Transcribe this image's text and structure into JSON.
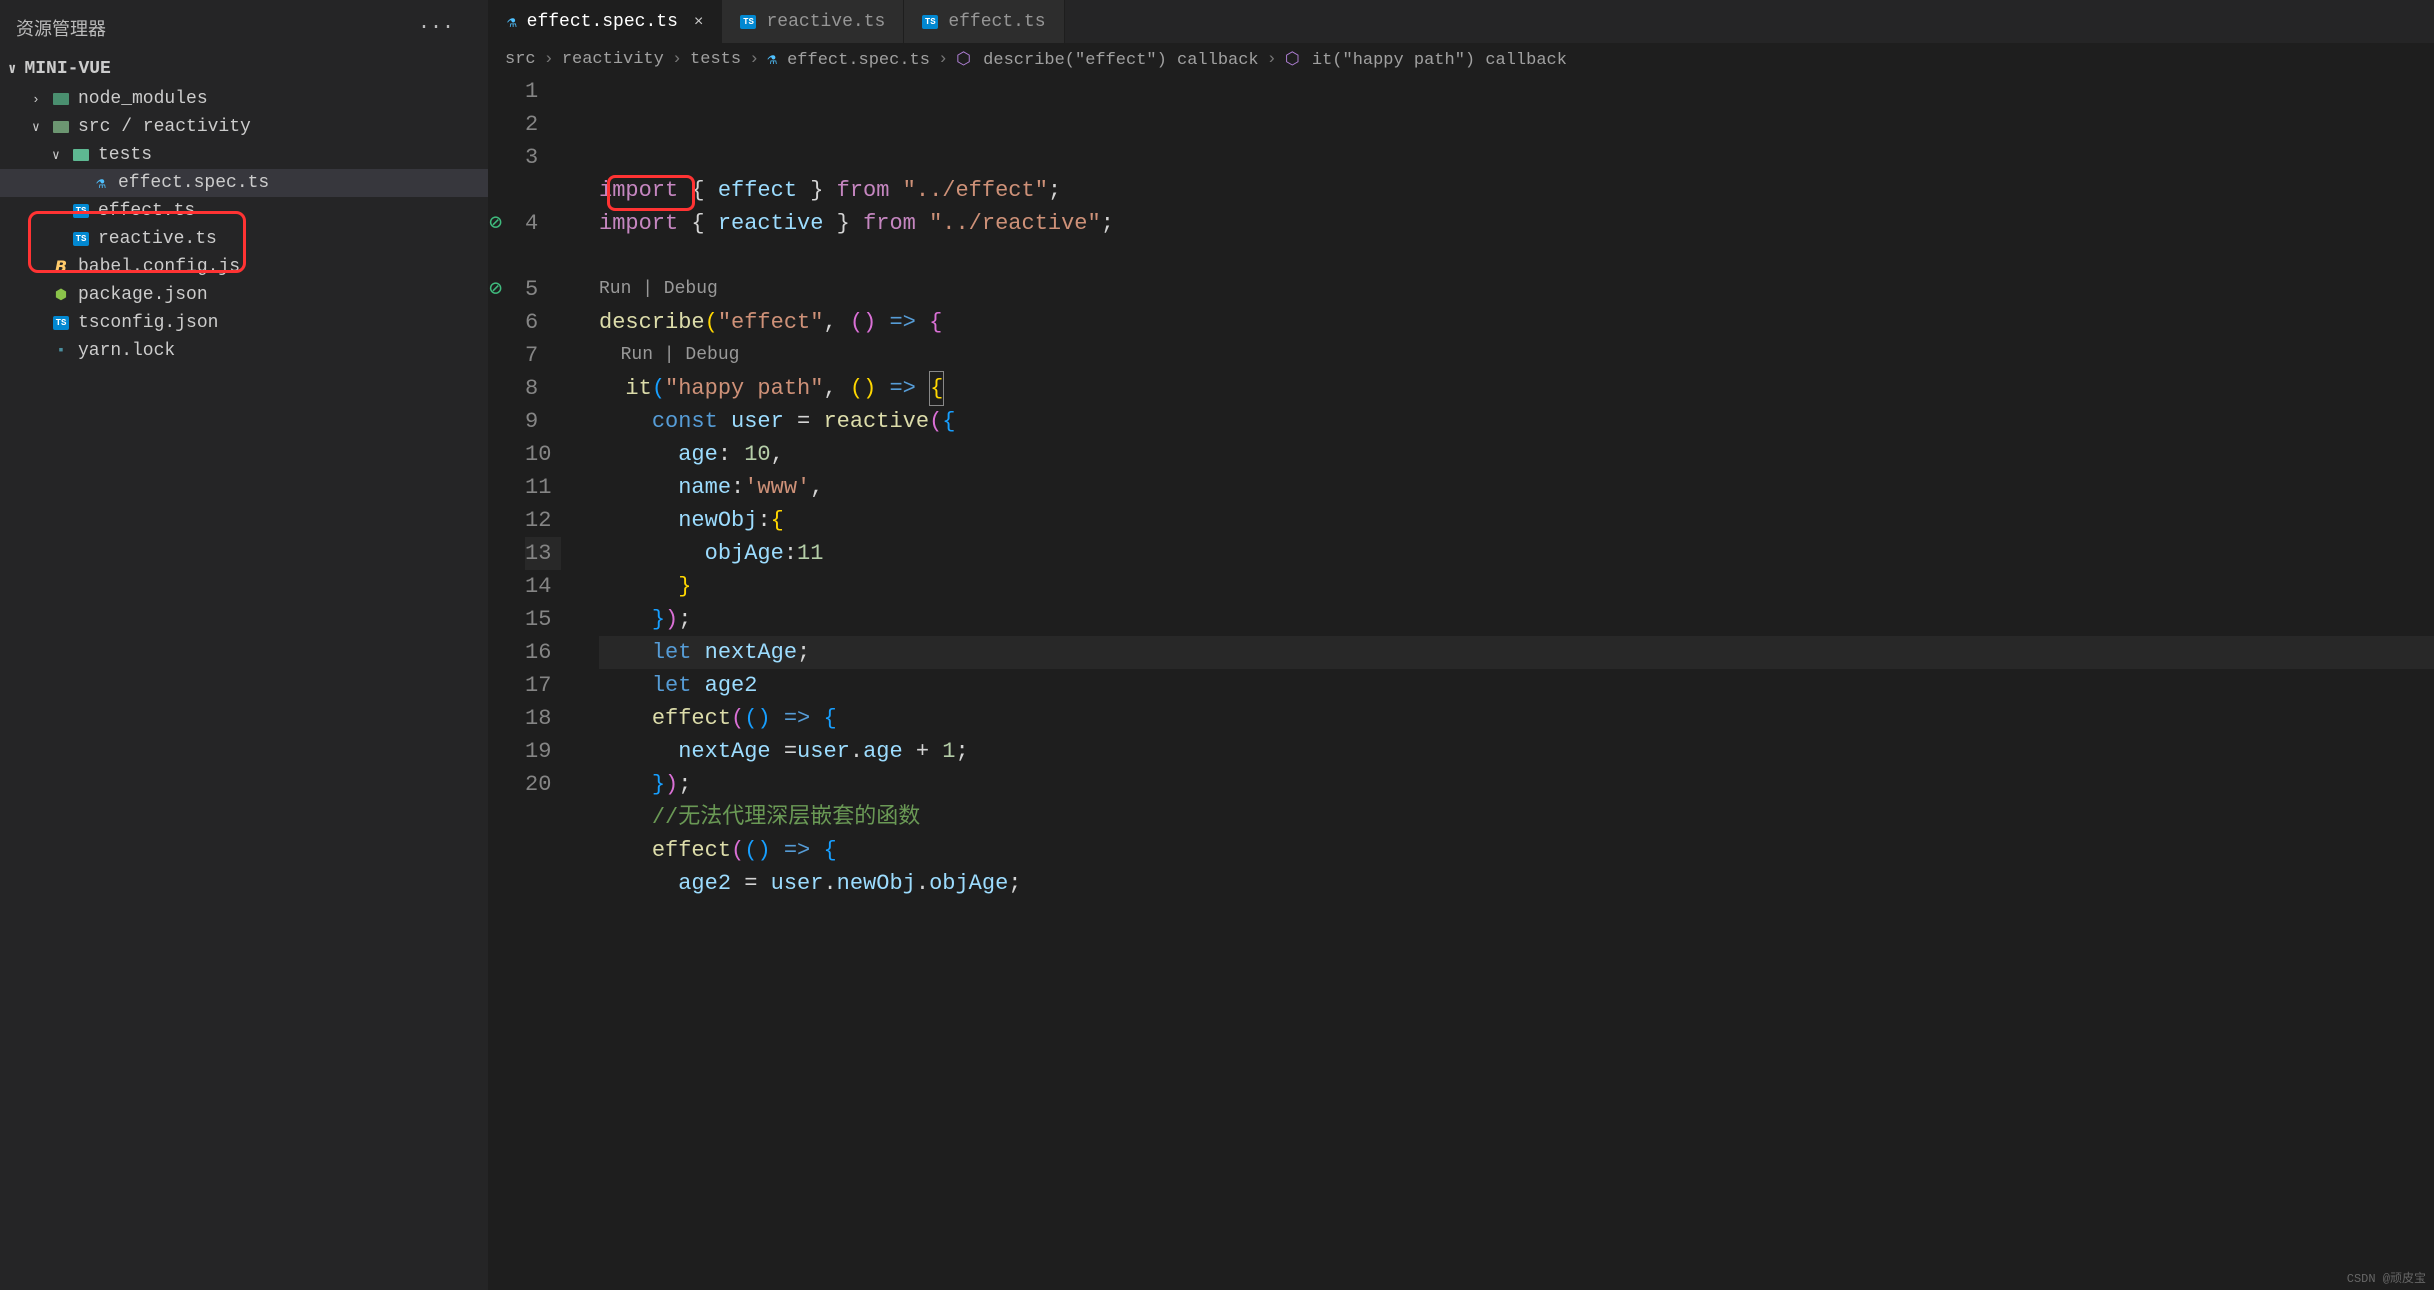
{
  "sidebar": {
    "title": "资源管理器",
    "project": "MINI-VUE",
    "tree": [
      {
        "type": "folder",
        "label": "node_modules",
        "expanded": false,
        "indent": 1,
        "iconColor": "#4a8f6f"
      },
      {
        "type": "folder",
        "label": "src / reactivity",
        "expanded": true,
        "indent": 1,
        "iconColor": "#6c9671"
      },
      {
        "type": "folder",
        "label": "tests",
        "expanded": true,
        "indent": 2,
        "iconColor": "#5eb892",
        "highlight": true
      },
      {
        "type": "file",
        "label": "effect.spec.ts",
        "icon": "flask",
        "indent": 3,
        "selected": true,
        "highlight": true
      },
      {
        "type": "file",
        "label": "effect.ts",
        "icon": "ts",
        "indent": 2
      },
      {
        "type": "file",
        "label": "reactive.ts",
        "icon": "ts",
        "indent": 2
      },
      {
        "type": "file",
        "label": "babel.config.js",
        "icon": "js",
        "indent": 1
      },
      {
        "type": "file",
        "label": "package.json",
        "icon": "json",
        "indent": 1
      },
      {
        "type": "file",
        "label": "tsconfig.json",
        "icon": "ts",
        "indent": 1
      },
      {
        "type": "file",
        "label": "yarn.lock",
        "icon": "generic",
        "indent": 1
      }
    ]
  },
  "tabs": [
    {
      "label": "effect.spec.ts",
      "icon": "flask",
      "active": true,
      "close": true
    },
    {
      "label": "reactive.ts",
      "icon": "ts",
      "active": false
    },
    {
      "label": "effect.ts",
      "icon": "ts",
      "active": false
    }
  ],
  "breadcrumb": [
    {
      "text": "src"
    },
    {
      "text": "reactivity"
    },
    {
      "text": "tests"
    },
    {
      "text": "effect.spec.ts",
      "icon": "flask"
    },
    {
      "text": "describe(\"effect\") callback",
      "icon": "symbol"
    },
    {
      "text": "it(\"happy path\") callback",
      "icon": "symbol"
    }
  ],
  "codelenses": {
    "line4": "Run | Debug",
    "line5": "Run | Debug"
  },
  "code": {
    "lines": [
      {
        "n": 1,
        "g": "",
        "tokens": [
          [
            "kw",
            "import"
          ],
          [
            "pn",
            " { "
          ],
          [
            "var",
            "effect"
          ],
          [
            "pn",
            " } "
          ],
          [
            "kw",
            "from"
          ],
          [
            "pn",
            " "
          ],
          [
            "str",
            "\"../effect\""
          ],
          [
            "pn",
            ";"
          ]
        ]
      },
      {
        "n": 2,
        "g": "",
        "tokens": [
          [
            "kw",
            "import"
          ],
          [
            "pn",
            " { "
          ],
          [
            "var",
            "reactive"
          ],
          [
            "pn",
            " } "
          ],
          [
            "kw",
            "from"
          ],
          [
            "pn",
            " "
          ],
          [
            "str",
            "\"../reactive\""
          ],
          [
            "pn",
            ";"
          ]
        ]
      },
      {
        "n": 3,
        "g": "",
        "tokens": []
      },
      {
        "codelens": "line4",
        "indent": 0
      },
      {
        "n": 4,
        "g": "check",
        "tokens": [
          [
            "fn",
            "describe"
          ],
          [
            "brace-y",
            "("
          ],
          [
            "str",
            "\"effect\""
          ],
          [
            "pn",
            ", "
          ],
          [
            "brace-p",
            "("
          ],
          [
            "brace-p",
            ") "
          ],
          [
            "const",
            "=>"
          ],
          [
            "pn",
            " "
          ],
          [
            "brace-p",
            "{"
          ]
        ]
      },
      {
        "codelens": "line5",
        "indent": 1
      },
      {
        "n": 5,
        "g": "check",
        "tokens": [
          [
            "pn",
            "  "
          ],
          [
            "fn",
            "it"
          ],
          [
            "brace-b",
            "("
          ],
          [
            "str",
            "\"happy path\""
          ],
          [
            "pn",
            ", "
          ],
          [
            "brace-y",
            "("
          ],
          [
            "brace-y",
            ") "
          ],
          [
            "const",
            "=>"
          ],
          [
            "pn",
            " "
          ],
          [
            "brace-y-hl",
            "{"
          ]
        ]
      },
      {
        "n": 6,
        "g": "",
        "tokens": [
          [
            "pn",
            "    "
          ],
          [
            "const",
            "const"
          ],
          [
            "pn",
            " "
          ],
          [
            "var",
            "user"
          ],
          [
            "pn",
            " = "
          ],
          [
            "fn",
            "reactive"
          ],
          [
            "brace-p",
            "("
          ],
          [
            "brace-b",
            "{"
          ]
        ]
      },
      {
        "n": 7,
        "g": "",
        "tokens": [
          [
            "pn",
            "      "
          ],
          [
            "prop",
            "age"
          ],
          [
            "pn",
            ": "
          ],
          [
            "num",
            "10"
          ],
          [
            "pn",
            ","
          ]
        ]
      },
      {
        "n": 8,
        "g": "",
        "tokens": [
          [
            "pn",
            "      "
          ],
          [
            "prop",
            "name"
          ],
          [
            "pn",
            ":"
          ],
          [
            "str",
            "'www'"
          ],
          [
            "pn",
            ","
          ]
        ]
      },
      {
        "n": 9,
        "g": "",
        "tokens": [
          [
            "pn",
            "      "
          ],
          [
            "prop",
            "newObj"
          ],
          [
            "pn",
            ":"
          ],
          [
            "brace-y",
            "{"
          ]
        ]
      },
      {
        "n": 10,
        "g": "",
        "tokens": [
          [
            "pn",
            "        "
          ],
          [
            "prop",
            "objAge"
          ],
          [
            "pn",
            ":"
          ],
          [
            "num",
            "11"
          ]
        ]
      },
      {
        "n": 11,
        "g": "",
        "tokens": [
          [
            "pn",
            "      "
          ],
          [
            "brace-y",
            "}"
          ]
        ]
      },
      {
        "n": 12,
        "g": "",
        "tokens": [
          [
            "pn",
            "    "
          ],
          [
            "brace-b",
            "}"
          ],
          [
            "brace-p",
            ")"
          ],
          [
            "pn",
            ";"
          ]
        ]
      },
      {
        "n": 13,
        "g": "",
        "current": true,
        "tokens": [
          [
            "pn",
            "    "
          ],
          [
            "const",
            "let"
          ],
          [
            "pn",
            " "
          ],
          [
            "var",
            "nextAge"
          ],
          [
            "pn",
            ";"
          ]
        ]
      },
      {
        "n": 14,
        "g": "",
        "tokens": [
          [
            "pn",
            "    "
          ],
          [
            "const",
            "let"
          ],
          [
            "pn",
            " "
          ],
          [
            "var",
            "age2"
          ]
        ]
      },
      {
        "n": 15,
        "g": "",
        "tokens": [
          [
            "pn",
            "    "
          ],
          [
            "fn",
            "effect"
          ],
          [
            "brace-p",
            "("
          ],
          [
            "brace-b",
            "("
          ],
          [
            "brace-b",
            ") "
          ],
          [
            "const",
            "=>"
          ],
          [
            "pn",
            " "
          ],
          [
            "brace-b",
            "{"
          ]
        ]
      },
      {
        "n": 16,
        "g": "",
        "tokens": [
          [
            "pn",
            "      "
          ],
          [
            "var",
            "nextAge"
          ],
          [
            "pn",
            " ="
          ],
          [
            "var",
            "user"
          ],
          [
            "pn",
            "."
          ],
          [
            "prop",
            "age"
          ],
          [
            "pn",
            " + "
          ],
          [
            "num",
            "1"
          ],
          [
            "pn",
            ";"
          ]
        ]
      },
      {
        "n": 17,
        "g": "",
        "tokens": [
          [
            "pn",
            "    "
          ],
          [
            "brace-b",
            "}"
          ],
          [
            "brace-p",
            ")"
          ],
          [
            "pn",
            ";"
          ]
        ]
      },
      {
        "n": 18,
        "g": "",
        "tokens": [
          [
            "pn",
            "    "
          ],
          [
            "cmt",
            "//无法代理深层嵌套的函数"
          ]
        ]
      },
      {
        "n": 19,
        "g": "",
        "tokens": [
          [
            "pn",
            "    "
          ],
          [
            "fn",
            "effect"
          ],
          [
            "brace-p",
            "("
          ],
          [
            "brace-b",
            "("
          ],
          [
            "brace-b",
            ") "
          ],
          [
            "const",
            "=>"
          ],
          [
            "pn",
            " "
          ],
          [
            "brace-b",
            "{"
          ]
        ]
      },
      {
        "n": 20,
        "g": "",
        "tokens": [
          [
            "pn",
            "      "
          ],
          [
            "var",
            "age2"
          ],
          [
            "pn",
            " = "
          ],
          [
            "var",
            "user"
          ],
          [
            "pn",
            "."
          ],
          [
            "prop",
            "newObj"
          ],
          [
            "pn",
            "."
          ],
          [
            "prop",
            "objAge"
          ],
          [
            "pn",
            ";"
          ]
        ]
      }
    ]
  },
  "watermark": "CSDN @顽皮宝"
}
